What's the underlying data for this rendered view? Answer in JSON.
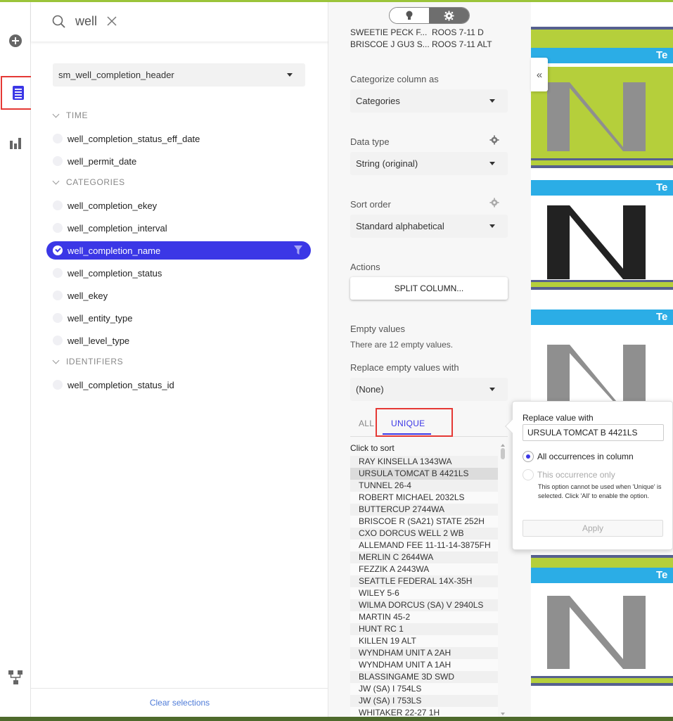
{
  "search": {
    "value": "well"
  },
  "fields_panel": {
    "table_select": "sm_well_completion_header",
    "groups": [
      {
        "title": "TIME",
        "items": [
          "well_completion_status_eff_date",
          "well_permit_date"
        ]
      },
      {
        "title": "CATEGORIES",
        "items": [
          "well_completion_ekey",
          "well_completion_interval",
          "well_completion_name",
          "well_completion_status",
          "well_ekey",
          "well_entity_type",
          "well_level_type"
        ]
      },
      {
        "title": "IDENTIFIERS",
        "items": [
          "well_completion_status_id"
        ]
      }
    ],
    "selected_item": "well_completion_name",
    "clear_label": "Clear selections"
  },
  "settings": {
    "preview_rows": [
      [
        "SWEETIE PECK F...",
        "ROOS 7-11 D"
      ],
      [
        "BRISCOE J GU3 S...",
        "ROOS 7-11 ALT"
      ]
    ],
    "categorize_label": "Categorize column as",
    "categorize_value": "Categories",
    "data_type_label": "Data type",
    "data_type_value": "String (original)",
    "sort_order_label": "Sort order",
    "sort_order_value": "Standard alphabetical",
    "actions_label": "Actions",
    "split_button": "SPLIT COLUMN...",
    "empty_label": "Empty values",
    "empty_note": "There are 12 empty values.",
    "replace_label": "Replace empty values with",
    "replace_value": "(None)",
    "tab_all": "ALL",
    "tab_unique": "UNIQUE",
    "click_to_sort": "Click to sort",
    "values": [
      "RAY KINSELLA 1343WA",
      "URSULA TOMCAT B 4421LS",
      "TUNNEL 26-4",
      "ROBERT MICHAEL 2032LS",
      "BUTTERCUP 2744WA",
      "BRISCOE R (SA21) STATE 252H",
      "CXO DORCUS WELL 2 WB",
      "ALLEMAND FEE 11-11-14-3875FH",
      "MERLIN C 2644WA",
      "FEZZIK A 2443WA",
      "SEATTLE FEDERAL 14X-35H",
      "WILEY 5-6",
      "WILMA DORCUS (SA) V 2940LS",
      "MARTIN 45-2",
      "HUNT RC 1",
      "KILLEN 19 ALT",
      "WYNDHAM UNIT A 2AH",
      "WYNDHAM UNIT A 1AH",
      "BLASSINGAME 3D SWD",
      "JW (SA) I 754LS",
      "JW (SA) I 753LS",
      "WHITAKER 22-27 1H"
    ],
    "highlighted_value": "URSULA TOMCAT B 4421LS"
  },
  "popup": {
    "label": "Replace value with",
    "input_value": "URSULA TOMCAT B 4421LS",
    "option_all": "All occurrences in column",
    "option_this": "This occurrence only",
    "note": "This option cannot be used when 'Unique' is selected. Click 'All' to enable the option.",
    "apply": "Apply"
  },
  "canvas": {
    "sheet_title_fragment": "Te",
    "sheet_letter": "N"
  },
  "colors": {
    "accent": "#3b37e6",
    "highlight_red": "#e53935",
    "sheet_green": "#b5cf3b",
    "sheet_blue": "#2bade6",
    "sheet_navy": "#56608f"
  }
}
